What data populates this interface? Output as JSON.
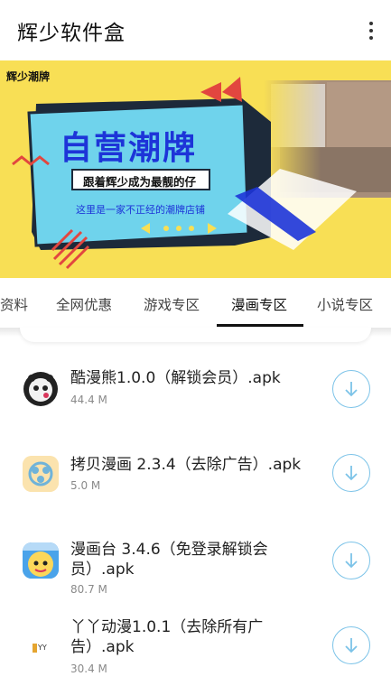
{
  "app": {
    "title": "辉少软件盒"
  },
  "banner": {
    "brand": "辉少潮牌",
    "headline": "自营潮牌",
    "slogan": "跟着辉少成为最靓的仔",
    "tagline": "这里是一家不正经的潮牌店铺"
  },
  "tabs": [
    {
      "label": "资料",
      "active": false
    },
    {
      "label": "全网优惠",
      "active": false
    },
    {
      "label": "游戏专区",
      "active": false
    },
    {
      "label": "漫画专区",
      "active": true
    },
    {
      "label": "小说专区",
      "active": false
    }
  ],
  "items": [
    {
      "name": "酷漫熊1.0.0（解锁会员）.apk",
      "size": "44.4 M",
      "icon": "bear-app-icon"
    },
    {
      "name": "拷贝漫画 2.3.4（去除广告）.apk",
      "size": "5.0 M",
      "icon": "copy-manga-app-icon"
    },
    {
      "name": "漫画台 3.4.6（免登录解锁会员）.apk",
      "size": "80.7 M",
      "icon": "manhuatai-app-icon"
    },
    {
      "name": "丫丫动漫1.0.1（去除所有广告）.apk",
      "size": "30.4 M",
      "icon": "yaya-app-icon"
    }
  ],
  "colors": {
    "banner_yellow": "#f8df55",
    "accent_blue": "#7cc3e8",
    "panel_blue": "#6fd3ec",
    "headline_blue": "#1d34d8"
  }
}
